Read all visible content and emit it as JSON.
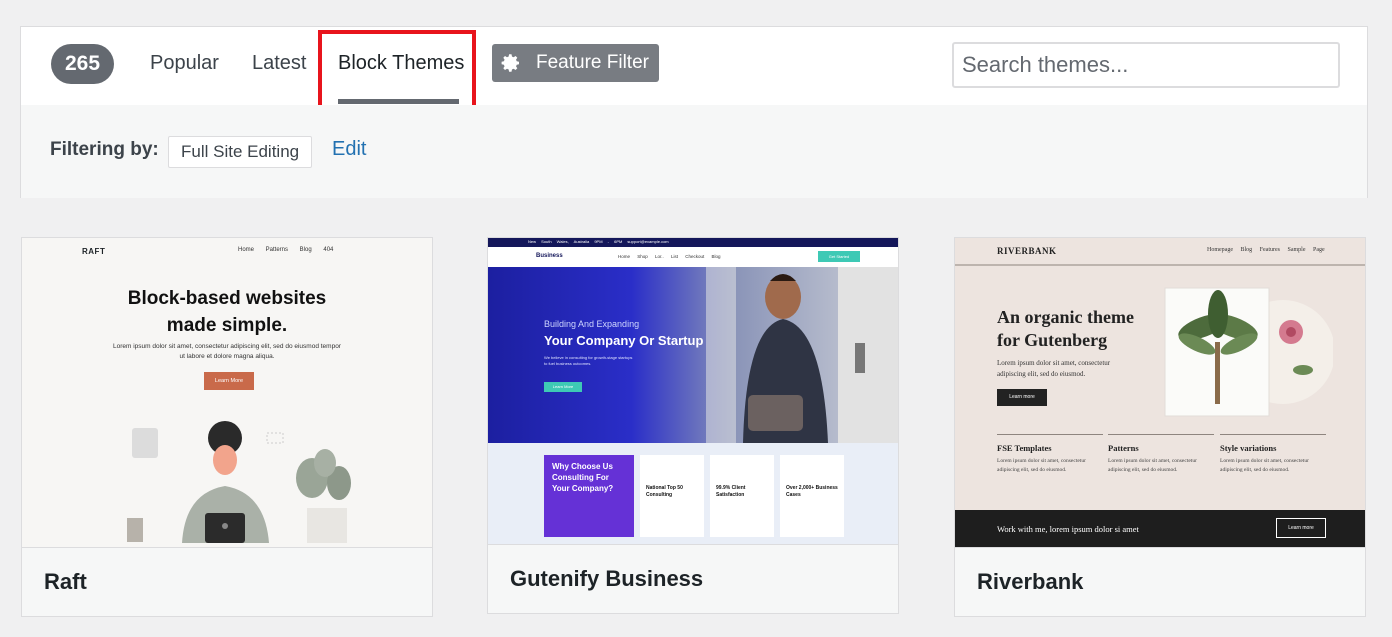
{
  "filter_bar": {
    "count": "265",
    "tabs": [
      {
        "label": "Popular"
      },
      {
        "label": "Latest"
      },
      {
        "label": "Block Themes",
        "active": true
      }
    ],
    "feature_filter_label": "Feature Filter",
    "search_placeholder": "Search themes...",
    "filtering_by_label": "Filtering by:",
    "active_filter": "Full Site Editing",
    "edit_label": "Edit"
  },
  "themes": [
    {
      "name": "Raft",
      "preview": {
        "logo": "RAFT",
        "nav": "Home Patterns Blog 404",
        "heading_line1": "Block-based websites",
        "heading_line2": "made simple.",
        "text": "Lorem ipsum dolor sit amet, consectetur adipiscing elit, sed do eiusmod tempor ut labore et dolore magna aliqua.",
        "button": "Learn More"
      }
    },
    {
      "name": "Gutenify Business",
      "preview": {
        "topbar": "New South Wales, Australia  9PM - 6PM  support@example.com",
        "logo": "Business",
        "nav": "Home Shop Lor.. List Checkout Blog",
        "cta": "Get Started",
        "hero_small": "Building And Expanding",
        "hero_title": "Your Company Or Startup",
        "hero_text": "We believe in consulting for growth-stage startups to fuel business outcomes.",
        "hero_button": "Learn More",
        "why_title": "Why Choose Us Consulting For Your Company?",
        "boxes": [
          "National Top 50 Consulting",
          "99.9% Client Satisfaction",
          "Over 2,000+ Business Cases"
        ]
      }
    },
    {
      "name": "Riverbank",
      "preview": {
        "logo": "RIVERBANK",
        "nav": "Homepage Blog Features Sample Page",
        "heading": "An organic theme for Gutenberg",
        "text": "Lorem ipsum dolor sit amet, consectetur adipiscing elit, sed do eiusmod.",
        "button": "Learn more",
        "columns": [
          {
            "title": "FSE Templates",
            "text": "Lorem ipsum dolor sit amet, consectetur adipiscing elit, sed do eiusmod."
          },
          {
            "title": "Patterns",
            "text": "Lorem ipsum dolor sit amet, consectetur adipiscing elit, sed do eiusmod."
          },
          {
            "title": "Style variations",
            "text": "Lorem ipsum dolor sit amet, consectetur adipiscing elit, sed do eiusmod."
          }
        ],
        "footer_text": "Work with me, lorem ipsum dolor si amet",
        "footer_button": "Learn more"
      }
    }
  ],
  "colors": {
    "highlight": "#e8141c",
    "link": "#2271b1",
    "count_badge": "#646970"
  }
}
